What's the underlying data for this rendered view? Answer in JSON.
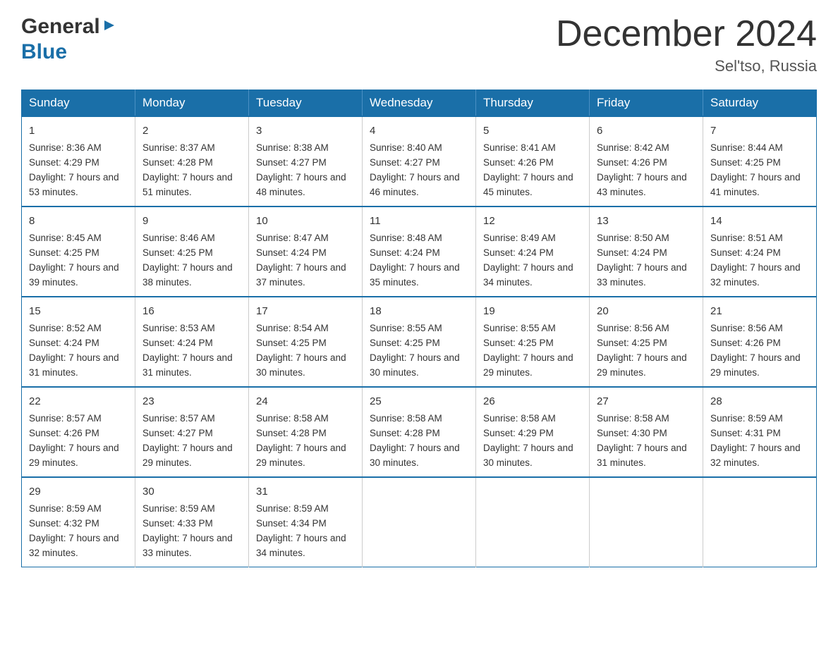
{
  "header": {
    "logo_general": "General",
    "logo_blue": "Blue",
    "month_title": "December 2024",
    "location": "Sel'tso, Russia"
  },
  "days_of_week": [
    "Sunday",
    "Monday",
    "Tuesday",
    "Wednesday",
    "Thursday",
    "Friday",
    "Saturday"
  ],
  "weeks": [
    [
      {
        "day": "1",
        "sunrise": "8:36 AM",
        "sunset": "4:29 PM",
        "daylight": "7 hours and 53 minutes."
      },
      {
        "day": "2",
        "sunrise": "8:37 AM",
        "sunset": "4:28 PM",
        "daylight": "7 hours and 51 minutes."
      },
      {
        "day": "3",
        "sunrise": "8:38 AM",
        "sunset": "4:27 PM",
        "daylight": "7 hours and 48 minutes."
      },
      {
        "day": "4",
        "sunrise": "8:40 AM",
        "sunset": "4:27 PM",
        "daylight": "7 hours and 46 minutes."
      },
      {
        "day": "5",
        "sunrise": "8:41 AM",
        "sunset": "4:26 PM",
        "daylight": "7 hours and 45 minutes."
      },
      {
        "day": "6",
        "sunrise": "8:42 AM",
        "sunset": "4:26 PM",
        "daylight": "7 hours and 43 minutes."
      },
      {
        "day": "7",
        "sunrise": "8:44 AM",
        "sunset": "4:25 PM",
        "daylight": "7 hours and 41 minutes."
      }
    ],
    [
      {
        "day": "8",
        "sunrise": "8:45 AM",
        "sunset": "4:25 PM",
        "daylight": "7 hours and 39 minutes."
      },
      {
        "day": "9",
        "sunrise": "8:46 AM",
        "sunset": "4:25 PM",
        "daylight": "7 hours and 38 minutes."
      },
      {
        "day": "10",
        "sunrise": "8:47 AM",
        "sunset": "4:24 PM",
        "daylight": "7 hours and 37 minutes."
      },
      {
        "day": "11",
        "sunrise": "8:48 AM",
        "sunset": "4:24 PM",
        "daylight": "7 hours and 35 minutes."
      },
      {
        "day": "12",
        "sunrise": "8:49 AM",
        "sunset": "4:24 PM",
        "daylight": "7 hours and 34 minutes."
      },
      {
        "day": "13",
        "sunrise": "8:50 AM",
        "sunset": "4:24 PM",
        "daylight": "7 hours and 33 minutes."
      },
      {
        "day": "14",
        "sunrise": "8:51 AM",
        "sunset": "4:24 PM",
        "daylight": "7 hours and 32 minutes."
      }
    ],
    [
      {
        "day": "15",
        "sunrise": "8:52 AM",
        "sunset": "4:24 PM",
        "daylight": "7 hours and 31 minutes."
      },
      {
        "day": "16",
        "sunrise": "8:53 AM",
        "sunset": "4:24 PM",
        "daylight": "7 hours and 31 minutes."
      },
      {
        "day": "17",
        "sunrise": "8:54 AM",
        "sunset": "4:25 PM",
        "daylight": "7 hours and 30 minutes."
      },
      {
        "day": "18",
        "sunrise": "8:55 AM",
        "sunset": "4:25 PM",
        "daylight": "7 hours and 30 minutes."
      },
      {
        "day": "19",
        "sunrise": "8:55 AM",
        "sunset": "4:25 PM",
        "daylight": "7 hours and 29 minutes."
      },
      {
        "day": "20",
        "sunrise": "8:56 AM",
        "sunset": "4:25 PM",
        "daylight": "7 hours and 29 minutes."
      },
      {
        "day": "21",
        "sunrise": "8:56 AM",
        "sunset": "4:26 PM",
        "daylight": "7 hours and 29 minutes."
      }
    ],
    [
      {
        "day": "22",
        "sunrise": "8:57 AM",
        "sunset": "4:26 PM",
        "daylight": "7 hours and 29 minutes."
      },
      {
        "day": "23",
        "sunrise": "8:57 AM",
        "sunset": "4:27 PM",
        "daylight": "7 hours and 29 minutes."
      },
      {
        "day": "24",
        "sunrise": "8:58 AM",
        "sunset": "4:28 PM",
        "daylight": "7 hours and 29 minutes."
      },
      {
        "day": "25",
        "sunrise": "8:58 AM",
        "sunset": "4:28 PM",
        "daylight": "7 hours and 30 minutes."
      },
      {
        "day": "26",
        "sunrise": "8:58 AM",
        "sunset": "4:29 PM",
        "daylight": "7 hours and 30 minutes."
      },
      {
        "day": "27",
        "sunrise": "8:58 AM",
        "sunset": "4:30 PM",
        "daylight": "7 hours and 31 minutes."
      },
      {
        "day": "28",
        "sunrise": "8:59 AM",
        "sunset": "4:31 PM",
        "daylight": "7 hours and 32 minutes."
      }
    ],
    [
      {
        "day": "29",
        "sunrise": "8:59 AM",
        "sunset": "4:32 PM",
        "daylight": "7 hours and 32 minutes."
      },
      {
        "day": "30",
        "sunrise": "8:59 AM",
        "sunset": "4:33 PM",
        "daylight": "7 hours and 33 minutes."
      },
      {
        "day": "31",
        "sunrise": "8:59 AM",
        "sunset": "4:34 PM",
        "daylight": "7 hours and 34 minutes."
      },
      null,
      null,
      null,
      null
    ]
  ],
  "labels": {
    "sunrise": "Sunrise:",
    "sunset": "Sunset:",
    "daylight": "Daylight:"
  }
}
